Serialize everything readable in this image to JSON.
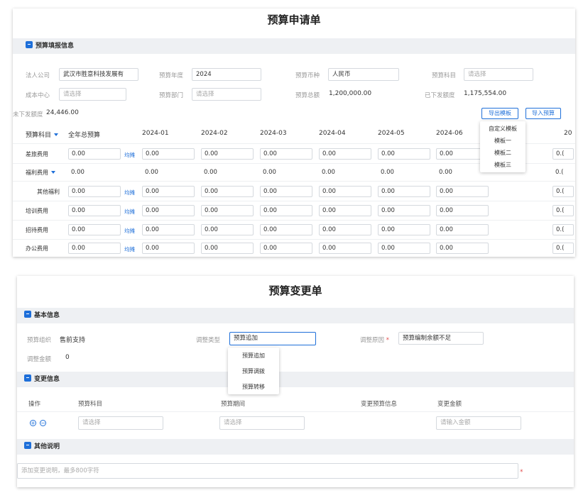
{
  "request_form": {
    "title": "预算申请单",
    "section": "预算填报信息",
    "fields": {
      "company": {
        "label": "法人公司",
        "value": "武汉市胜意科技发展有"
      },
      "year": {
        "label": "预算年度",
        "value": "2024"
      },
      "currency": {
        "label": "预算币种",
        "value": "人民币"
      },
      "subject": {
        "label": "预算科目",
        "placeholder": "请选择"
      },
      "cost_center": {
        "label": "成本中心",
        "placeholder": "请选择"
      },
      "department": {
        "label": "预算部门",
        "placeholder": "请选择"
      },
      "total": {
        "label": "预算总额",
        "value": "1,200,000.00"
      },
      "issued": {
        "label": "已下发额度",
        "value": "1,175,554.00"
      },
      "unissued": {
        "label": "未下发额度",
        "value": "24,446.00"
      }
    },
    "buttons": {
      "export_template": "导出模板",
      "import_budget": "导入预算"
    },
    "export_menu": [
      "自定义模板",
      "模板一",
      "模板二",
      "模板三"
    ],
    "table": {
      "headers": [
        "预算科目",
        "全年总预算",
        "2024-01",
        "2024-02",
        "2024-03",
        "2024-04",
        "2024-05",
        "2024-06",
        "20"
      ],
      "avg_label": "均摊",
      "rows": [
        {
          "name": "差旅费用",
          "total": "0.00",
          "avg": true,
          "cells": [
            "0.00",
            "0.00",
            "0.00",
            "0.00",
            "0.00",
            "0.00",
            "0.("
          ]
        },
        {
          "name": "福利费用",
          "total": "0.00",
          "avg": false,
          "cells": [
            "0.00",
            "0.00",
            "0.00",
            "0.00",
            "0.00",
            "0.00",
            "0.("
          ]
        },
        {
          "name": "其他福利",
          "total": "0.00",
          "avg": true,
          "cells": [
            "0.00",
            "0.00",
            "0.00",
            "0.00",
            "0.00",
            "0.00",
            "0.("
          ]
        },
        {
          "name": "培训费用",
          "total": "0.00",
          "avg": true,
          "cells": [
            "0.00",
            "0.00",
            "0.00",
            "0.00",
            "0.00",
            "0.00",
            "0.("
          ]
        },
        {
          "name": "招待费用",
          "total": "0.00",
          "avg": true,
          "cells": [
            "0.00",
            "0.00",
            "0.00",
            "0.00",
            "0.00",
            "0.00",
            "0.("
          ]
        },
        {
          "name": "办公费用",
          "total": "0.00",
          "avg": true,
          "cells": [
            "0.00",
            "0.00",
            "0.00",
            "0.00",
            "0.00",
            "0.00",
            "0.("
          ]
        }
      ]
    }
  },
  "change_form": {
    "title": "预算变更单",
    "section_basic": "基本信息",
    "org": {
      "label": "预算组织",
      "value": "售前支持"
    },
    "type": {
      "label": "调整类型",
      "value": "预算追加"
    },
    "reason": {
      "label": "调整原因",
      "required": "*",
      "value": "预算编制余额不足"
    },
    "amount": {
      "label": "调整金额",
      "value": "0"
    },
    "type_menu": [
      "预算追加",
      "预算调拨",
      "预算转移"
    ],
    "section_change": "变更信息",
    "change_table": {
      "headers": [
        "操作",
        "预算科目",
        "预算期间",
        "变更预算信息",
        "变更金额"
      ],
      "add_icon": "+",
      "remove_icon": "−",
      "subject_placeholder": "请选择",
      "period_placeholder": "请选择",
      "amount_placeholder": "请输入金额"
    },
    "section_other": "其他说明",
    "note_placeholder": "添加变更说明，最多800字符",
    "note_required": "*"
  }
}
